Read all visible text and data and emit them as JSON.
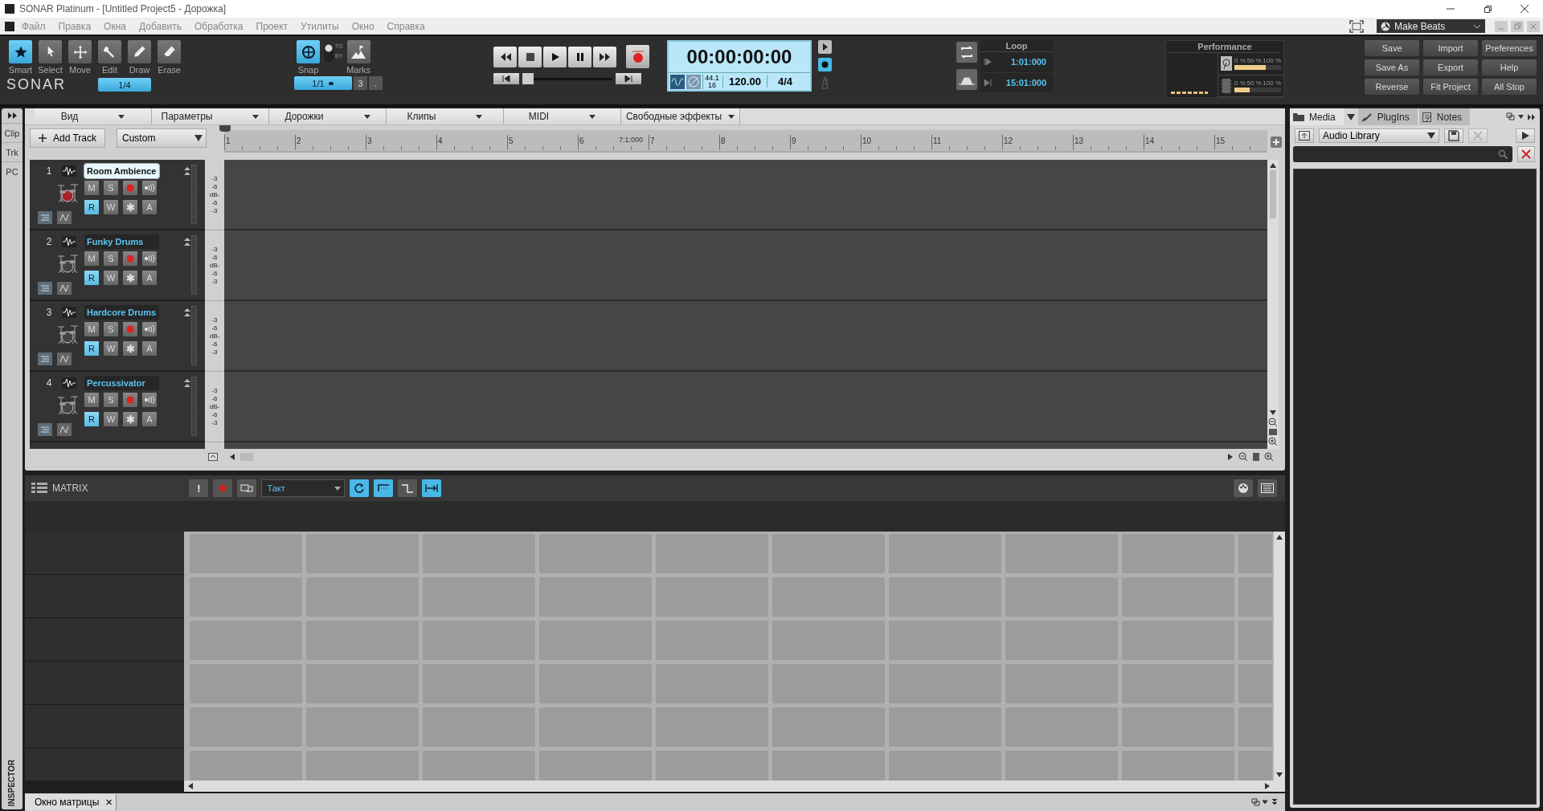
{
  "window": {
    "title": "SONAR Platinum - [Untitled Project5 - Дорожка]"
  },
  "menu": [
    "Файл",
    "Правка",
    "Окна",
    "Добавить",
    "Обработка",
    "Проект",
    "Утилиты",
    "Окно",
    "Справка"
  ],
  "workspace": "Make Beats",
  "tools": [
    {
      "label": "Smart",
      "kind": "star",
      "selected": true
    },
    {
      "label": "Select",
      "kind": "arrow",
      "selected": false
    },
    {
      "label": "Move",
      "kind": "move",
      "selected": false
    },
    {
      "label": "Edit",
      "kind": "wrench",
      "selected": false
    },
    {
      "label": "Draw",
      "kind": "pencil",
      "selected": false
    },
    {
      "label": "Erase",
      "kind": "eraser",
      "selected": false
    }
  ],
  "logo": "SONAR",
  "tool_resolution": "1/4",
  "snap": {
    "label": "Snap",
    "on": true,
    "to": "TO",
    "by": "BY",
    "marks": "Marks",
    "value": "1/1",
    "triplet": "3",
    "dotted": "."
  },
  "transport": {
    "time": "00:00:00:00",
    "sample_rate": "44.1",
    "bit_depth": "16",
    "tempo": "120.00",
    "meter": "4/4",
    "record_armed": true,
    "position": {
      "level": 0
    }
  },
  "loop": {
    "title": "Loop",
    "start": "1:01:000",
    "end": "15:01:000"
  },
  "performance": {
    "title": "Performance",
    "meters": [
      {
        "kind": "disk",
        "scale": [
          "0 %",
          "50 %",
          "100 %"
        ],
        "level": 0.67
      },
      {
        "kind": "cpu",
        "scale": [
          "0 %",
          "50 %",
          "100 %"
        ],
        "level": 0.33
      }
    ]
  },
  "buttons": [
    "Save",
    "Import",
    "Preferences",
    "Save As",
    "Export",
    "Help",
    "Reverse",
    "Fit Project",
    "All Stop"
  ],
  "inspector": {
    "tabs": [
      "Clip",
      "Trk",
      "PC"
    ],
    "label": "INSPECTOR"
  },
  "track_menus": [
    "Вид",
    "Параметры",
    "Дорожки",
    "Клипы",
    "MIDI",
    "Свободные эффекты"
  ],
  "add_track": "Add Track",
  "preset": "Custom",
  "ruler": [
    {
      "label": "1"
    },
    {
      "label": "2"
    },
    {
      "label": "3"
    },
    {
      "label": "4"
    },
    {
      "label": "5"
    },
    {
      "label": "6",
      "now_marker": "7:1:000"
    },
    {
      "label": "7"
    },
    {
      "label": "8"
    },
    {
      "label": "9"
    },
    {
      "label": "10"
    },
    {
      "label": "11"
    },
    {
      "label": "12"
    },
    {
      "label": "13"
    },
    {
      "label": "14"
    },
    {
      "label": "15"
    }
  ],
  "tracks": [
    {
      "number": "1",
      "name": "Room Ambience",
      "selected": true,
      "read_on": true,
      "buttons": {
        "mute": "M",
        "solo": "S",
        "read": "R",
        "write": "W",
        "freeze": "✱",
        "archive": "A"
      },
      "meter_scale": [
        "-3",
        "-6",
        "dB-",
        "-6",
        "-3"
      ]
    },
    {
      "number": "2",
      "name": "Funky Drums",
      "selected": false,
      "read_on": true,
      "buttons": {
        "mute": "M",
        "solo": "S",
        "read": "R",
        "write": "W",
        "freeze": "✱",
        "archive": "A"
      },
      "meter_scale": [
        "-3",
        "-6",
        "dB-",
        "-6",
        "-3"
      ]
    },
    {
      "number": "3",
      "name": "Hardcore Drums",
      "selected": false,
      "read_on": true,
      "buttons": {
        "mute": "M",
        "solo": "S",
        "read": "R",
        "write": "W",
        "freeze": "✱",
        "archive": "A"
      },
      "meter_scale": [
        "-3",
        "-6",
        "dB-",
        "-6",
        "-3"
      ]
    },
    {
      "number": "4",
      "name": "Percussivator",
      "selected": false,
      "read_on": true,
      "buttons": {
        "mute": "M",
        "solo": "S",
        "read": "R",
        "write": "W",
        "freeze": "✱",
        "archive": "A"
      },
      "meter_scale": [
        "-3",
        "-6",
        "dB-",
        "-6",
        "-3"
      ]
    }
  ],
  "matrix": {
    "title": "MATRIX",
    "alert": "!",
    "quantize": "Такт"
  },
  "bottom_tab": {
    "label": "Окно матрицы",
    "close": "×"
  },
  "browser": {
    "tabs": [
      {
        "label": "Media",
        "selected": true
      },
      {
        "label": "PlugIns",
        "selected": false
      },
      {
        "label": "Notes",
        "selected": false
      }
    ],
    "library": "Audio Library"
  }
}
